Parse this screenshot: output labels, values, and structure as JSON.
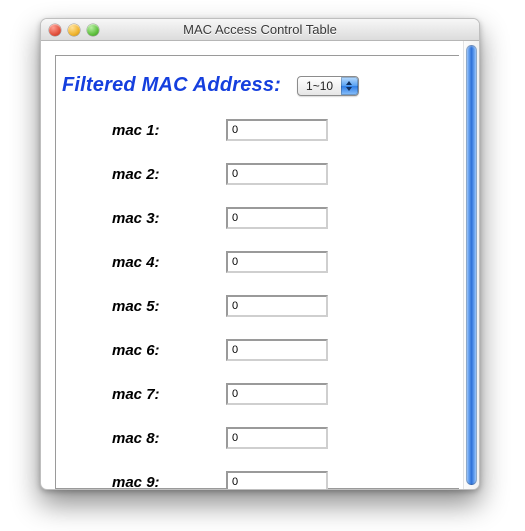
{
  "window": {
    "title": "MAC Access Control Table"
  },
  "heading": "Filtered MAC Address:",
  "range_select": {
    "selected": "1~10"
  },
  "rows": [
    {
      "label": "mac 1:",
      "value": "0"
    },
    {
      "label": "mac 2:",
      "value": "0"
    },
    {
      "label": "mac 3:",
      "value": "0"
    },
    {
      "label": "mac 4:",
      "value": "0"
    },
    {
      "label": "mac 5:",
      "value": "0"
    },
    {
      "label": "mac 6:",
      "value": "0"
    },
    {
      "label": "mac 7:",
      "value": "0"
    },
    {
      "label": "mac 8:",
      "value": "0"
    },
    {
      "label": "mac 9:",
      "value": "0"
    }
  ]
}
